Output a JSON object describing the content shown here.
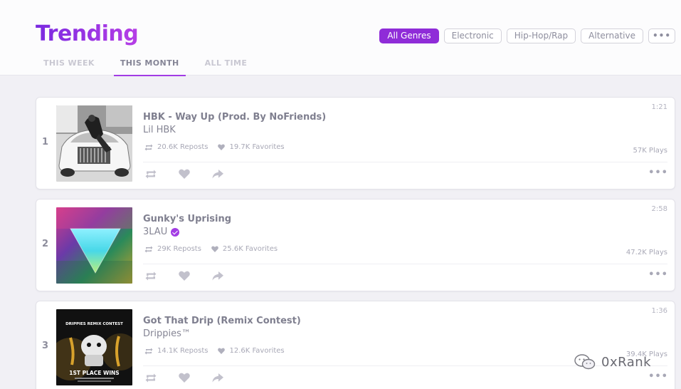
{
  "header": {
    "title": "Trending",
    "periods": [
      "THIS WEEK",
      "THIS MONTH",
      "ALL TIME"
    ],
    "active_period": 1,
    "genres": [
      "All Genres",
      "Electronic",
      "Hip-Hop/Rap",
      "Alternative"
    ],
    "genres_more": "•••",
    "active_genre": 0
  },
  "tracks": [
    {
      "rank": "1",
      "title": "HBK - Way Up (Prod. By NoFriends)",
      "artist": "Lil HBK",
      "verified": false,
      "reposts": "20.6K Reposts",
      "favorites": "19.7K Favorites",
      "duration": "1:21",
      "plays": "57K Plays"
    },
    {
      "rank": "2",
      "title": "Gunky's Uprising",
      "artist": "3LAU",
      "verified": true,
      "reposts": "29K Reposts",
      "favorites": "25.6K Favorites",
      "duration": "2:58",
      "plays": "47.2K Plays"
    },
    {
      "rank": "3",
      "title": "Got That Drip (Remix Contest)",
      "artist": "Drippies™",
      "verified": false,
      "reposts": "14.1K Reposts",
      "favorites": "12.6K Favorites",
      "duration": "1:36",
      "plays": "39.4K Plays"
    }
  ],
  "art3": {
    "heading": "DRIPPIES REMIX CONTEST",
    "footer": "1ST PLACE WINS"
  },
  "more_label": "•••",
  "watermark": "0xRank",
  "colors": {
    "accent": "#a23ce4",
    "accent_dark": "#8f2cd8",
    "background": "#f1f0f5"
  }
}
